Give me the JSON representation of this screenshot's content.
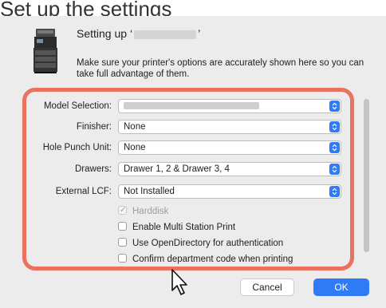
{
  "top_caption": "Set up the settings",
  "dialog": {
    "title_prefix": "Setting up ‘",
    "title_suffix": "’",
    "description": "Make sure your printer's options are accurately shown here so you can take full advantage of them."
  },
  "options": [
    {
      "label": "Model Selection:",
      "value": ""
    },
    {
      "label": "Finisher:",
      "value": "None"
    },
    {
      "label": "Hole Punch Unit:",
      "value": "None"
    },
    {
      "label": "Drawers:",
      "value": "Drawer 1, 2 & Drawer 3, 4"
    },
    {
      "label": "External LCF:",
      "value": "Not Installed"
    }
  ],
  "checkboxes": [
    {
      "label": "Harddisk",
      "checked": true,
      "disabled": true
    },
    {
      "label": "Enable Multi Station Print",
      "checked": false,
      "disabled": false
    },
    {
      "label": "Use OpenDirectory for authentication",
      "checked": false,
      "disabled": false
    },
    {
      "label": "Confirm department code when printing",
      "checked": false,
      "disabled": false
    }
  ],
  "buttons": {
    "cancel": "Cancel",
    "ok": "OK"
  },
  "colors": {
    "accent": "#2f7bf5",
    "highlight_frame": "#e9735e",
    "sheet_bg": "#ececec"
  }
}
